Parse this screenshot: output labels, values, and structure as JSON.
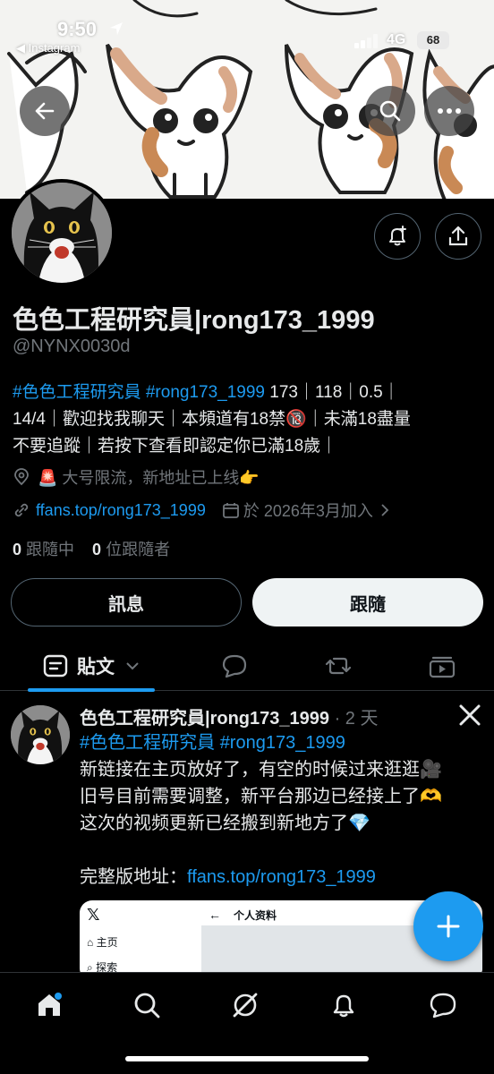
{
  "status_bar": {
    "time": "9:50",
    "back_app": "◀ Instagram",
    "network": "4G",
    "battery": "68"
  },
  "header": {
    "back_icon": "back-arrow-icon",
    "search_icon": "search-icon",
    "more_icon": "more-icon"
  },
  "profile": {
    "name": "色色工程研究員|rong173_1999",
    "handle": "@NYNX0030d",
    "bio": {
      "tag1": "#色色工程研究員",
      "tag2": "#rong173_1999",
      "text1": " 173｜118｜0.5｜",
      "text2": "14/4｜歡迎找我聊天｜本頻道有18禁🔞｜未滿18盡量",
      "text3": "不要追蹤｜若按下查看即認定你已滿18歲｜"
    },
    "location": "🚨 大号限流，新地址已上线👉",
    "link": "ffans.top/rong173_1999",
    "joined": "於 2026年3月加入",
    "following_count": "0",
    "following_label": " 跟隨中",
    "followers_count": "0",
    "followers_label": " 位跟隨者"
  },
  "buttons": {
    "message": "訊息",
    "follow": "跟隨"
  },
  "tabs": {
    "posts": "貼文"
  },
  "tweet": {
    "name": "色色工程研究員|rong173_1999",
    "meta": " · 2 天",
    "tag1": "#色色工程研究員",
    "tag2": "#rong173_1999",
    "line1": "新链接在主页放好了，有空的时候过来逛逛🎥",
    "line2": "旧号目前需要调整，新平台那边已经接上了🫶",
    "line3": "这次的视频更新已经搬到新地方了💎",
    "line4_prefix": "完整版地址：",
    "line4_link": "ffans.top/rong173_1999",
    "embed": {
      "logo": "𝕏",
      "back": "←",
      "title": "个人资料",
      "menu1": "主页",
      "menu2": "探索"
    }
  },
  "colors": {
    "accent": "#1d9bf0",
    "background": "#000000",
    "muted": "#71767b"
  }
}
